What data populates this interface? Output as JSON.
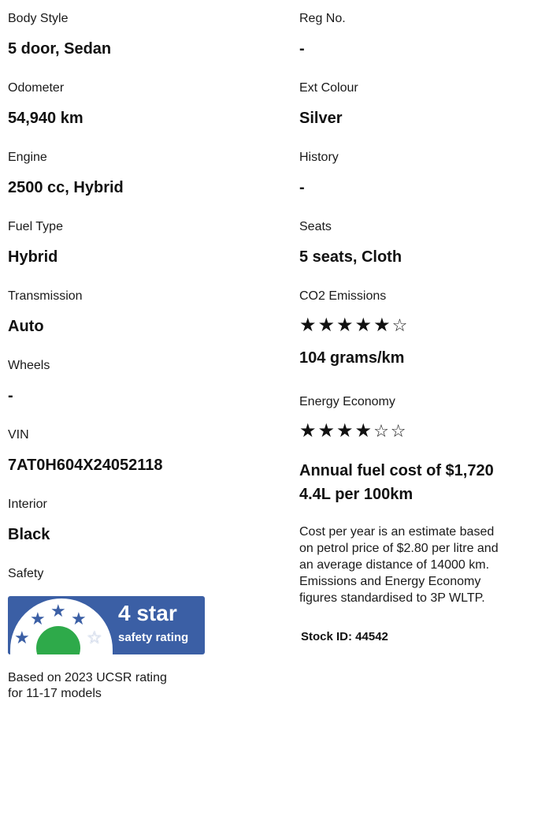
{
  "left": {
    "body_style": {
      "label": "Body Style",
      "value": "5 door, Sedan"
    },
    "odometer": {
      "label": "Odometer",
      "value": "54,940 km"
    },
    "engine": {
      "label": "Engine",
      "value": "2500 cc, Hybrid"
    },
    "fuel_type": {
      "label": "Fuel Type",
      "value": "Hybrid"
    },
    "transmission": {
      "label": "Transmission",
      "value": "Auto"
    },
    "wheels": {
      "label": "Wheels",
      "value": "-"
    },
    "vin": {
      "label": "VIN",
      "value": "7AT0H604X24052118"
    },
    "interior": {
      "label": "Interior",
      "value": "Black"
    },
    "safety": {
      "label": "Safety",
      "badge_big": "4 star",
      "badge_small": "safety rating",
      "rating_stars": 4,
      "rating_max": 5,
      "note_line1": "Based on 2023 UCSR rating",
      "note_line2": "for 11-17 models"
    }
  },
  "right": {
    "reg_no": {
      "label": "Reg No.",
      "value": "-"
    },
    "ext_colour": {
      "label": "Ext Colour",
      "value": "Silver"
    },
    "history": {
      "label": "History",
      "value": "-"
    },
    "seats": {
      "label": "Seats",
      "value": "5 seats, Cloth"
    },
    "co2": {
      "label": "CO2 Emissions",
      "stars": 5,
      "max": 6,
      "value": "104 grams/km"
    },
    "energy": {
      "label": "Energy Economy",
      "stars": 4,
      "max": 6
    },
    "fuel_cost": "Annual fuel cost of $1,720",
    "fuel_rate": "4.4L per 100km",
    "note": [
      "Cost per year is an estimate based",
      "on petrol price of  $2.80 per litre and",
      "an average distance of 14000 km.",
      "Emissions and Energy Economy",
      "figures standardised to 3P WLTP."
    ],
    "stock_id": "Stock ID: 44542"
  },
  "colors": {
    "badge_blue": "#3b5fa5",
    "badge_green": "#2eaa4a"
  }
}
